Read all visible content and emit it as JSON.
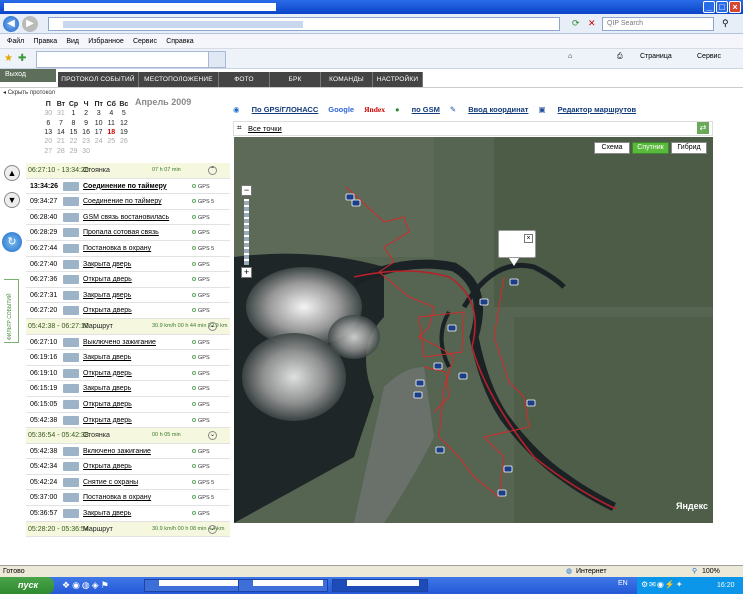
{
  "browser": {
    "search_placeholder": "QIP Search",
    "menu": [
      "Файл",
      "Правка",
      "Вид",
      "Избранное",
      "Сервис",
      "Справка"
    ],
    "fav_right": [
      "Страница",
      "Сервис"
    ],
    "status_text": "Готово",
    "zone": "Интернет",
    "zoom": "100%"
  },
  "app": {
    "exit_label": "Выход",
    "tabs": [
      "ПРОТОКОЛ СОБЫТИЙ",
      "МЕСТОПОЛОЖЕНИЕ",
      "ФОТО",
      "БРК",
      "КОМАНДЫ",
      "НАСТРОЙКИ"
    ],
    "hide_protocol": "Скрыть протокол",
    "calendar": {
      "title": "Апрель 2009",
      "weekdays": [
        "П",
        "Вт",
        "Ср",
        "Ч",
        "Пт",
        "Сб",
        "Вс"
      ],
      "weeks": [
        [
          {
            "d": "30",
            "o": true
          },
          {
            "d": "31",
            "o": true
          },
          {
            "d": "1"
          },
          {
            "d": "2"
          },
          {
            "d": "3"
          },
          {
            "d": "4"
          },
          {
            "d": "5"
          }
        ],
        [
          {
            "d": "6"
          },
          {
            "d": "7"
          },
          {
            "d": "8"
          },
          {
            "d": "9"
          },
          {
            "d": "10"
          },
          {
            "d": "11"
          },
          {
            "d": "12"
          }
        ],
        [
          {
            "d": "13"
          },
          {
            "d": "14"
          },
          {
            "d": "15"
          },
          {
            "d": "16"
          },
          {
            "d": "17"
          },
          {
            "d": "18",
            "r": true
          },
          {
            "d": "19"
          }
        ],
        [
          {
            "d": "20",
            "o": true
          },
          {
            "d": "21",
            "o": true
          },
          {
            "d": "22",
            "o": true
          },
          {
            "d": "23",
            "o": true
          },
          {
            "d": "24",
            "o": true
          },
          {
            "d": "25",
            "o": true
          },
          {
            "d": "26",
            "o": true
          }
        ],
        [
          {
            "d": "27",
            "o": true
          },
          {
            "d": "28",
            "o": true
          },
          {
            "d": "29",
            "o": true
          },
          {
            "d": "30",
            "o": true
          },
          {
            "d": "",
            "o": true
          },
          {
            "d": "",
            "o": true
          },
          {
            "d": "",
            "o": true
          }
        ]
      ]
    },
    "filter_label": "ФИЛЬТР СОБЫТИЙ",
    "map_links": [
      {
        "label": "По GPS/ГЛОНАСС",
        "kind": "link"
      },
      {
        "label": "Google",
        "kind": "plain"
      },
      {
        "label": "Яndex",
        "kind": "plain"
      },
      {
        "label": "по GSM",
        "kind": "link"
      },
      {
        "label": "Ввод координат",
        "kind": "link"
      },
      {
        "label": "Редактор маршрутов",
        "kind": "link"
      }
    ],
    "all_points": "Все точки",
    "map_modes": [
      "Схема",
      "Спутник",
      "Гибрид"
    ],
    "map_brand": "Яндекс",
    "events": [
      {
        "type": "hdr",
        "time": "06:27:10 - 13:34:26",
        "label": "Стоянка",
        "stat": "07 h 07 min",
        "chev": "⌃"
      },
      {
        "type": "ev",
        "time": "13:34:26",
        "label": "Соединение по таймеру",
        "gps": "GPS",
        "bold": true
      },
      {
        "type": "ev",
        "time": "09:34:27",
        "label": "Соединение по таймеру",
        "gps": "GPS 5"
      },
      {
        "type": "ev",
        "time": "06:28:40",
        "label": "GSM связь востановилась",
        "gps": "GPS"
      },
      {
        "type": "ev",
        "time": "06:28:29",
        "label": "Пропала сотовая связь",
        "gps": "GPS"
      },
      {
        "type": "ev",
        "time": "06:27:44",
        "label": "Постановка в охрану",
        "gps": "GPS 5"
      },
      {
        "type": "ev",
        "time": "06:27:40",
        "label": "Закрыта дверь",
        "gps": "GPS"
      },
      {
        "type": "ev",
        "time": "06:27:36",
        "label": "Открыта дверь",
        "gps": "GPS"
      },
      {
        "type": "ev",
        "time": "06:27:31",
        "label": "Закрыта дверь",
        "gps": "GPS"
      },
      {
        "type": "ev",
        "time": "06:27:20",
        "label": "Открыта дверь",
        "gps": "GPS"
      },
      {
        "type": "hdr",
        "time": "05:42:38 - 06:27:10",
        "label": "Маршрут",
        "stat": "30.9 km/h  00 h 44 min  22.9 km",
        "chev": "⌄"
      },
      {
        "type": "ev",
        "time": "06:27:10",
        "label": "Выключено зажигание",
        "gps": "GPS"
      },
      {
        "type": "ev",
        "time": "06:19:16",
        "label": "Закрыта дверь",
        "gps": "GPS"
      },
      {
        "type": "ev",
        "time": "06:19:10",
        "label": "Открыта дверь",
        "gps": "GPS"
      },
      {
        "type": "ev",
        "time": "06:15:19",
        "label": "Закрыта дверь",
        "gps": "GPS"
      },
      {
        "type": "ev",
        "time": "06:15:05",
        "label": "Открыта дверь",
        "gps": "GPS"
      },
      {
        "type": "ev",
        "time": "05:42:38",
        "label": "Открыта дверь",
        "gps": "GPS"
      },
      {
        "type": "hdr",
        "time": "05:36:54 - 05:42:38",
        "label": "Стоянка",
        "stat": "00 h 05 min",
        "chev": "⌄"
      },
      {
        "type": "ev",
        "time": "05:42:38",
        "label": "Включено зажигание",
        "gps": "GPS"
      },
      {
        "type": "ev",
        "time": "05:42:34",
        "label": "Открыта дверь",
        "gps": "GPS"
      },
      {
        "type": "ev",
        "time": "05:42:24",
        "label": "Снятие с охраны",
        "gps": "GPS 5"
      },
      {
        "type": "ev",
        "time": "05:37:00",
        "label": "Постановка в охрану",
        "gps": "GPS 5"
      },
      {
        "type": "ev",
        "time": "05:36:57",
        "label": "Закрыта дверь",
        "gps": "GPS"
      },
      {
        "type": "hdr",
        "time": "05:28:20 - 05:36:54",
        "label": "Маршрут",
        "stat": "30.9 km/h  00 h 08 min  4.4 km",
        "chev": "⌄"
      }
    ]
  },
  "taskbar": {
    "start": "пуск",
    "lang": "EN",
    "clock": "16:20"
  }
}
